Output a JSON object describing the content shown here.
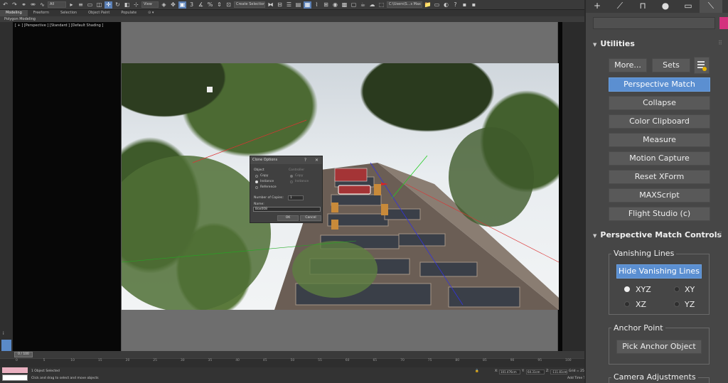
{
  "toolbar": {
    "undo": "↶",
    "redo": "↷",
    "link": "🔗",
    "unlink": "⛓",
    "bind": "∿",
    "selection_filter": "All",
    "view_dropdown": "View",
    "named_selection": "Create Selection Se",
    "workspace": "C:\\Users\\S...s Max 2020"
  },
  "ribbon": {
    "tabs": [
      "Modeling",
      "Freeform",
      "Selection",
      "Object Paint",
      "Populate"
    ],
    "sub_label": "Polygon Modeling"
  },
  "viewport": {
    "label": "[ + ] [Perspective ] [Standard ] [Default Shading ]"
  },
  "dialog": {
    "title": "Clone Options",
    "help": "?",
    "close": "✕",
    "object_label": "Object",
    "controller_label": "Controller",
    "options": [
      "Copy",
      "Instance",
      "Reference"
    ],
    "controller_options": [
      "Copy",
      "Instance"
    ],
    "copies_label": "Number of Copies:",
    "copies_value": "1",
    "name_label": "Name:",
    "name_value": "Box008",
    "ok": "OK",
    "cancel": "Cancel"
  },
  "timeline": {
    "slider": "0 / 100",
    "ticks": [
      "0",
      "5",
      "10",
      "15",
      "20",
      "25",
      "30",
      "35",
      "40",
      "45",
      "50",
      "55",
      "60",
      "65",
      "70",
      "75",
      "80",
      "85",
      "90",
      "95",
      "100"
    ]
  },
  "status": {
    "selected": "1 Object Selected",
    "prompt": "Click and drag to select and move objects",
    "x_label": "X:",
    "x": "101.476cm",
    "y_label": "Y:",
    "y": "64.31cm",
    "z_label": "Z:",
    "z": "-111.81cm",
    "grid": "Grid = 25.4cm",
    "add_time_tag": "Add Time Tag"
  },
  "panel": {
    "tabs": [
      "+",
      "⟋",
      "⊓",
      "●",
      "▭",
      "🔧"
    ],
    "utilities_title": "Utilities",
    "more_label": "More...",
    "sets_label": "Sets",
    "utility_buttons": [
      "Perspective Match",
      "Collapse",
      "Color Clipboard",
      "Measure",
      "Motion Capture",
      "Reset XForm",
      "MAXScript",
      "Flight Studio (c)"
    ],
    "pm_controls_title": "Perspective Match Controls",
    "vanishing_lines_title": "Vanishing Lines",
    "hide_vanishing_lines": "Hide Vanishing Lines",
    "axes": [
      "XYZ",
      "XY",
      "XZ",
      "YZ"
    ],
    "anchor_point_title": "Anchor Point",
    "pick_anchor_object": "Pick Anchor Object",
    "camera_adjustments_title": "Camera Adjustments"
  },
  "colors": {
    "accent": "#5b8fd1",
    "swatch": "#d4317d"
  }
}
